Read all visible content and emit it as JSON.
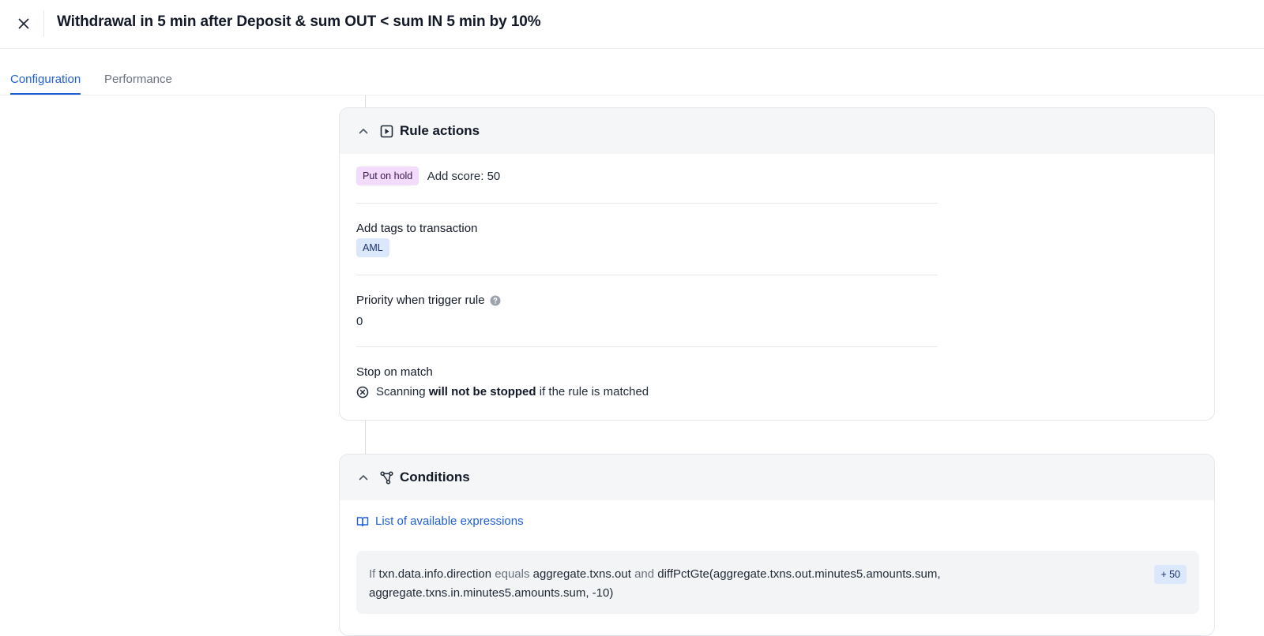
{
  "header": {
    "title": "Withdrawal in 5 min after Deposit & sum OUT < sum IN 5 min by 10%",
    "close_icon": "close-icon"
  },
  "tabs": [
    {
      "label": "Configuration",
      "active": true
    },
    {
      "label": "Performance",
      "active": false
    }
  ],
  "rule_actions": {
    "title": "Rule actions",
    "icon": "play-box-icon",
    "action_badge": "Put on hold",
    "score_text": "Add score: 50",
    "tags_label": "Add tags to transaction",
    "tags": [
      "AML"
    ],
    "priority_label": "Priority when trigger rule",
    "priority_value": "0",
    "stop_label": "Stop on match",
    "stop_prefix": "Scanning",
    "stop_bold": "will not be stopped",
    "stop_suffix": "if the rule is matched"
  },
  "conditions": {
    "title": "Conditions",
    "icon": "branch-icon",
    "link_text": "List of available expressions",
    "rule": {
      "if": "If",
      "field": "txn.data.info.direction",
      "operator": "equals",
      "value": "aggregate.txns.out",
      "joiner": "and",
      "expr_line1": "diffPctGte(aggregate.txns.out.minutes5.amounts.sum,",
      "expr_line2": "aggregate.txns.in.minutes5.amounts.sum, -10)",
      "score": "+ 50"
    }
  },
  "colors": {
    "accent": "#1f5fd6",
    "hold_badge_bg": "#f3dcfb",
    "tag_badge_bg": "#dbe7fb",
    "card_header_bg": "#f5f6f8"
  }
}
